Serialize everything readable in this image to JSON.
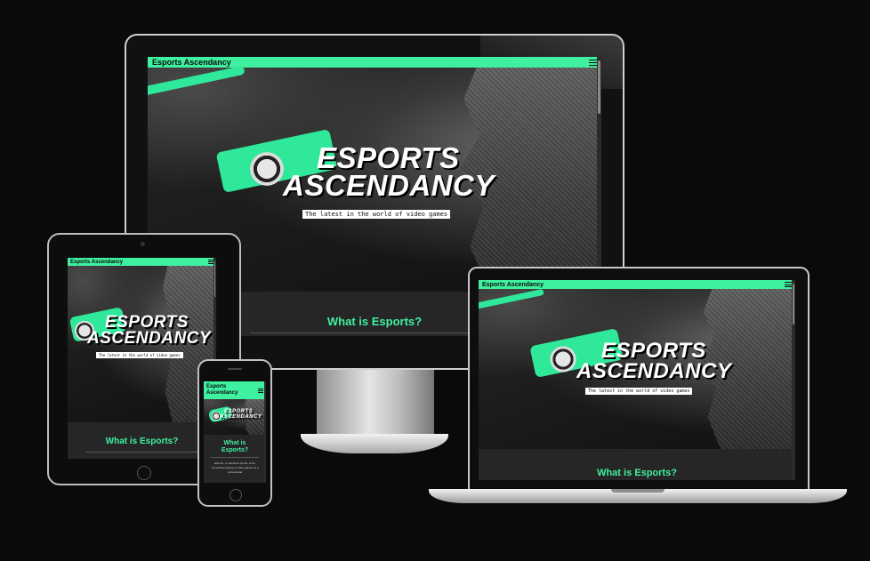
{
  "site": {
    "brand": "Esports Ascendancy",
    "hero_line1": "ESPORTS",
    "hero_line2": "ASCENDANCY",
    "tagline": "The latest in the world of video games",
    "section_title": "What is Esports?",
    "phone_body": "Esports, or electronic sports, is the competitive playing of video games as a professional",
    "menu_icon": "hamburger-menu-icon"
  },
  "colors": {
    "accent": "#3ff0a0",
    "background": "#0a0a0a",
    "section": "#262626"
  }
}
